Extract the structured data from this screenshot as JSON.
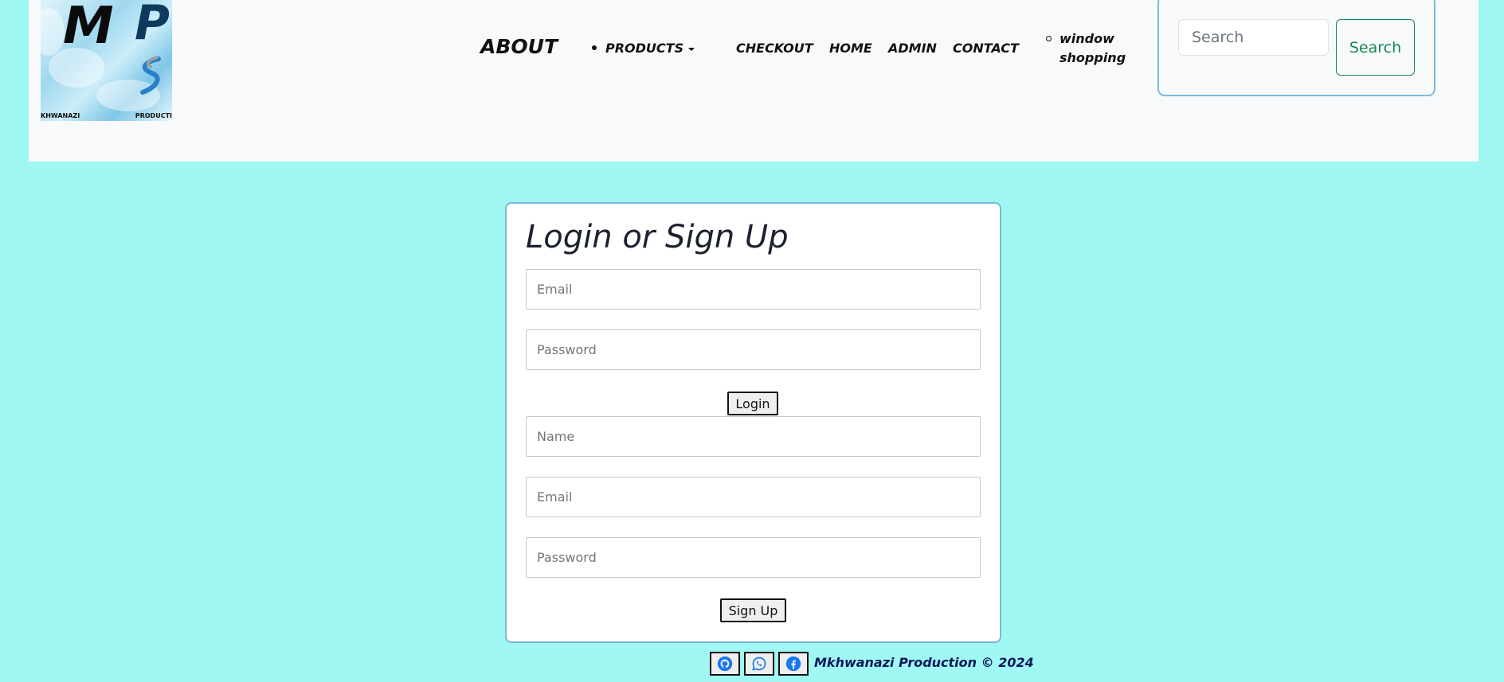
{
  "header": {
    "logo": {
      "letters": [
        "M",
        "P"
      ],
      "caption_left": "KHWANAZI",
      "caption_right": "PRODUCTI"
    },
    "nav": {
      "about": "ABOUT",
      "products": "PRODUCTS",
      "checkout": "CHECKOUT",
      "home": "HOME",
      "admin": "ADMIN",
      "contact": "CONTACT",
      "window_shopping": "window shopping"
    },
    "search": {
      "placeholder": "Search",
      "button_label": "Search"
    }
  },
  "auth": {
    "title": "Login or Sign Up",
    "login": {
      "email_placeholder": "Email",
      "password_placeholder": "Password",
      "button_label": "Login"
    },
    "signup": {
      "name_placeholder": "Name",
      "email_placeholder": "Email",
      "password_placeholder": "Password",
      "button_label": "Sign Up"
    }
  },
  "footer": {
    "icons": [
      "github-icon",
      "whatsapp-icon",
      "facebook-icon"
    ],
    "text": "Mkhwanazi Production © 2024"
  },
  "colors": {
    "page_background": "#a1f7f3",
    "navbar_background": "#f8f9fa",
    "search_button": "#198754",
    "footer_text": "#0a1a5c",
    "facebook_blue": "#1877f2"
  }
}
